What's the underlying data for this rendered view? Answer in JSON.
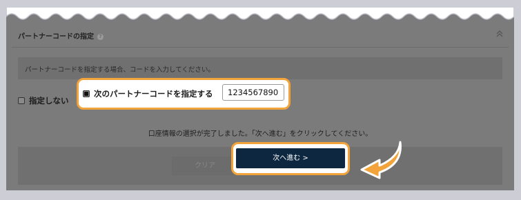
{
  "section": {
    "title": "パートナーコードの指定",
    "help_glyph": "?",
    "info_text": "パートナーコードを指定する場合、コードを入力してください。"
  },
  "options": {
    "none_label": "指定しない",
    "specify_label": "次のパートナーコードを指定する",
    "specify_checked": true,
    "none_checked": false
  },
  "code_input": {
    "value": "1234567890"
  },
  "status_text": "口座情報の選択が完了しました。「次へ進む」をクリックしてください。",
  "buttons": {
    "clear_label": "クリア",
    "next_label": "次へ進む >"
  },
  "colors": {
    "highlight": "#f2a33a",
    "next_button_bg": "#0d2740",
    "overlay": "#7b7b7b"
  }
}
